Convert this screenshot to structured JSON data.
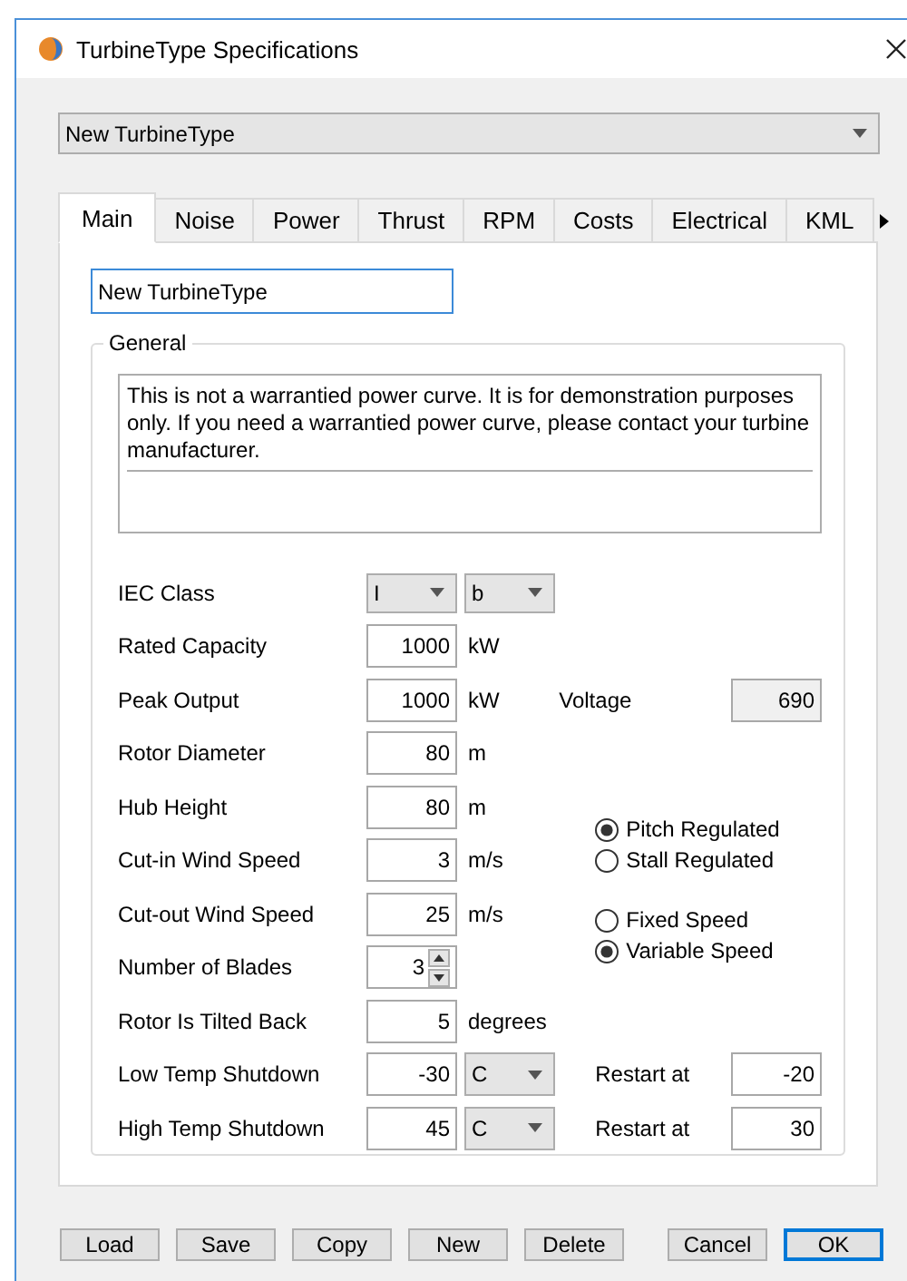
{
  "window": {
    "title": "TurbineType Specifications"
  },
  "type_selector": {
    "value": "New TurbineType"
  },
  "tabs": [
    {
      "label": "Main",
      "selected": true
    },
    {
      "label": "Noise",
      "selected": false
    },
    {
      "label": "Power",
      "selected": false
    },
    {
      "label": "Thrust",
      "selected": false
    },
    {
      "label": "RPM",
      "selected": false
    },
    {
      "label": "Costs",
      "selected": false
    },
    {
      "label": "Electrical",
      "selected": false
    },
    {
      "label": "KML",
      "selected": false
    }
  ],
  "name_field": {
    "value": "New TurbineType"
  },
  "general": {
    "title": "General",
    "note": "This is not a warrantied power curve. It is for demonstration purposes only. If you need a warrantied power curve, please contact your turbine manufacturer.",
    "fields": [
      {
        "kind": "combos",
        "label": "IEC Class",
        "values": [
          "I",
          "b"
        ]
      },
      {
        "kind": "input",
        "label": "Rated Capacity",
        "value": "1000",
        "unit": "kW"
      },
      {
        "kind": "input",
        "label": "Peak Output",
        "value": "1000",
        "unit": "kW"
      },
      {
        "kind": "input",
        "label": "Rotor Diameter",
        "value": "80",
        "unit": "m"
      },
      {
        "kind": "input",
        "label": "Hub Height",
        "value": "80",
        "unit": "m"
      },
      {
        "kind": "input",
        "label": "Cut-in Wind Speed",
        "value": "3",
        "unit": "m/s"
      },
      {
        "kind": "input",
        "label": "Cut-out Wind Speed",
        "value": "25",
        "unit": "m/s"
      },
      {
        "kind": "spinner",
        "label": "Number of Blades",
        "value": "3"
      },
      {
        "kind": "input",
        "label": "Rotor Is Tilted Back",
        "value": "5",
        "unit": "degrees"
      },
      {
        "kind": "input_combo",
        "label": "Low Temp Shutdown",
        "value": "-30",
        "unit": "C"
      },
      {
        "kind": "input_combo",
        "label": "High Temp Shutdown",
        "value": "45",
        "unit": "C"
      }
    ],
    "voltage": {
      "label": "Voltage",
      "value": "690"
    },
    "regulation": [
      {
        "label": "Pitch Regulated",
        "selected": true
      },
      {
        "label": "Stall Regulated",
        "selected": false
      }
    ],
    "speed": [
      {
        "label": "Fixed Speed",
        "selected": false
      },
      {
        "label": "Variable Speed",
        "selected": true
      }
    ],
    "restart": [
      {
        "label": "Restart at",
        "value": "-20"
      },
      {
        "label": "Restart at",
        "value": "30"
      }
    ]
  },
  "buttons": [
    {
      "label": "Load",
      "default": false
    },
    {
      "label": "Save",
      "default": false
    },
    {
      "label": "Copy",
      "default": false
    },
    {
      "label": "New",
      "default": false
    },
    {
      "label": "Delete",
      "default": false
    },
    {
      "label": "Cancel",
      "default": false
    },
    {
      "label": "OK",
      "default": true
    }
  ]
}
